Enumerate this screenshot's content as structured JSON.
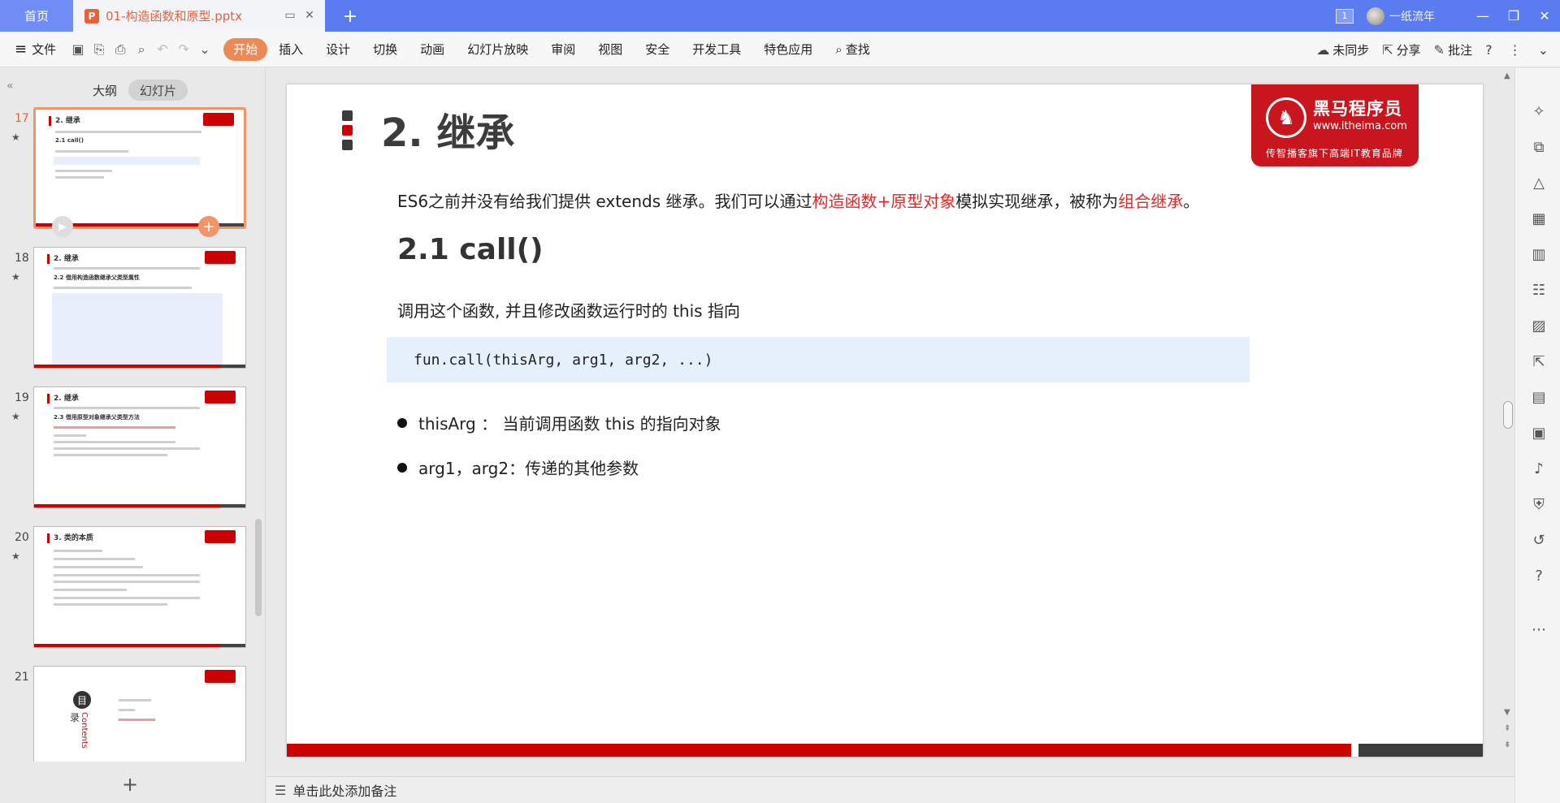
{
  "titlebar": {
    "home_tab": "首页",
    "doc_tab_title": "01-构造函数和原型.pptx",
    "ppt_icon": "P",
    "window_count": "1",
    "username": "一纸流年"
  },
  "ribbon": {
    "file_label": "文件",
    "tabs": [
      "开始",
      "插入",
      "设计",
      "切换",
      "动画",
      "幻灯片放映",
      "审阅",
      "视图",
      "安全",
      "开发工具",
      "特色应用"
    ],
    "search_label": "查找",
    "sync_label": "未同步",
    "share_label": "分享",
    "comment_label": "批注"
  },
  "left_panel": {
    "tab_outline": "大纲",
    "tab_slides": "幻灯片",
    "thumbs": [
      {
        "num": "17",
        "title": "2. 继承",
        "sub": "2.1 call()"
      },
      {
        "num": "18",
        "title": "2. 继承",
        "sub": "2.2 借用构造函数继承父类型属性"
      },
      {
        "num": "19",
        "title": "2. 继承",
        "sub": "2.3 借用原型对象继承父类型方法"
      },
      {
        "num": "20",
        "title": "3. 类的本质",
        "sub": ""
      },
      {
        "num": "21",
        "title": "",
        "sub": "Contents",
        "toc_char1": "目",
        "toc_char2": "录"
      }
    ]
  },
  "slide": {
    "title": "2. 继承",
    "logo_name": "黑马程序员",
    "logo_url": "www.itheima.com",
    "logo_slogan": "传智播客旗下高端IT教育品牌",
    "intro_part1": "ES6之前并没有给我们提供 extends 继承。我们可以通过",
    "intro_red1": "构造函数+原型对象",
    "intro_part2": "模拟实现继承，被称为",
    "intro_red2": "组合继承",
    "intro_end": "。",
    "subtitle": "2.1 call()",
    "desc": "调用这个函数, 并且修改函数运行时的 this 指向",
    "code": "fun.call(thisArg, arg1, arg2, ...)",
    "bullets": [
      "thisArg ： 当前调用函数 this 的指向对象",
      "arg1，arg2：传递的其他参数"
    ]
  },
  "notes": {
    "placeholder": "单击此处添加备注"
  },
  "colors": {
    "accent": "#e98a57",
    "titlebar": "#5b7cf0",
    "red": "#c00000",
    "highlight_red": "#e32727"
  }
}
